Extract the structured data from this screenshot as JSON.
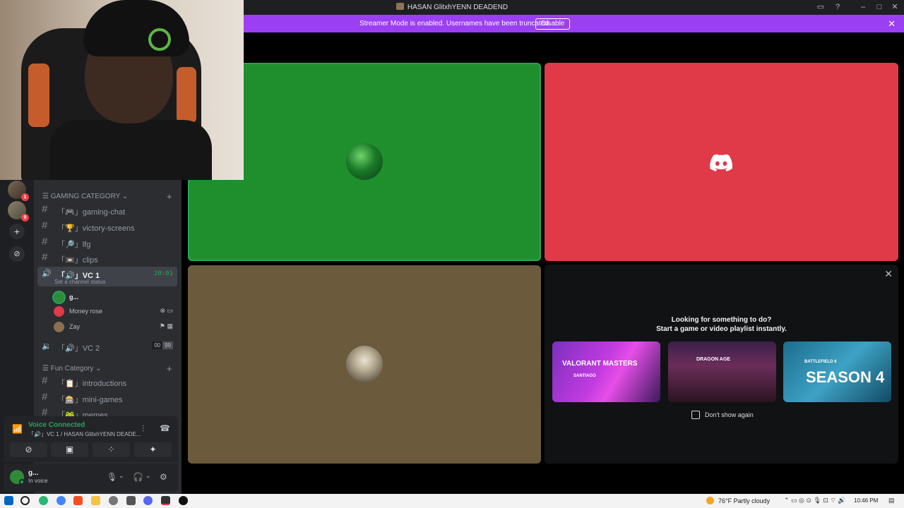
{
  "window": {
    "title": "HASAN GlitxhYENN DEADEND"
  },
  "notice": {
    "text": "Streamer Mode is enabled. Usernames have been truncated.",
    "button": "Disable"
  },
  "servers": [
    {
      "badge": "1"
    },
    {
      "badge": "9"
    }
  ],
  "categories": {
    "gaming": "GAMING CATEGORY",
    "fun": "Fun Category"
  },
  "channels": {
    "gaming_chat": "「🎮」gaming-chat",
    "victory_screens": "「🏆」victory-screens",
    "lfg": "「🔎」lfg",
    "clips": "「📼」clips",
    "vc1": "「🔊」VC 1",
    "vc1_timer": "20:01",
    "vc1_status": "Set a channel status",
    "vc2": "「🔊」VC 2",
    "vc2_counts": [
      "00",
      "99"
    ],
    "introductions": "「📋」introductions",
    "mini_games": "「🎰」mini-games",
    "memes": "「🐸」memes"
  },
  "members": [
    {
      "name": "g..."
    },
    {
      "name": "Money rose"
    },
    {
      "name": "Zay"
    }
  ],
  "voice": {
    "status": "Voice Connected",
    "channel": "「🔊」VC 1 / HASAN GlitxhYENN DEADE..."
  },
  "user": {
    "name": "g...",
    "status": "In voice"
  },
  "shelf": {
    "heading1": "Looking for something to do?",
    "heading2": "Start a game or video playlist instantly.",
    "cards": [
      {
        "label": "VALORANT MASTERS",
        "tag": "SANTIAGO"
      },
      {
        "label": "DRAGON AGE"
      },
      {
        "label": "SEASON 4",
        "tag": "BATTLEFIELD 6"
      }
    ],
    "checkbox": "Don't show again"
  },
  "taskbar": {
    "weather": "76°F  Partly cloudy",
    "time": "10:46 PM"
  },
  "colors": {
    "tile_green": "#1f8f2d",
    "tile_red": "#e03a48",
    "tile_olive": "#6b5a3c",
    "accent_purple": "#9b3ff2",
    "voice_green": "#23a55a"
  }
}
